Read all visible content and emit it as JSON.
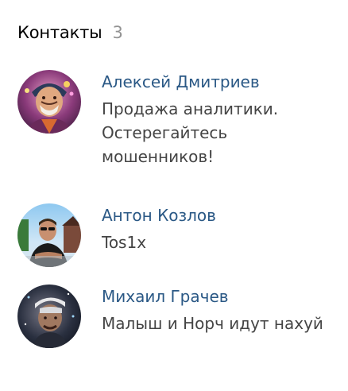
{
  "block": {
    "title": "Контакты",
    "count": "3"
  },
  "contacts": [
    {
      "name": "Алексей Дмитриев",
      "description": "Продажа аналитики. Остерегайтесь мошенников!",
      "avatar_icon": "avatar-photo"
    },
    {
      "name": "Антон Козлов",
      "description": "Tos1x",
      "avatar_icon": "avatar-photo"
    },
    {
      "name": "Михаил Грачев",
      "description": "Малыш и Норч идут нахуй",
      "avatar_icon": "avatar-photo"
    }
  ],
  "colors": {
    "link": "#2a5885",
    "text": "#444444",
    "muted": "#939393"
  }
}
